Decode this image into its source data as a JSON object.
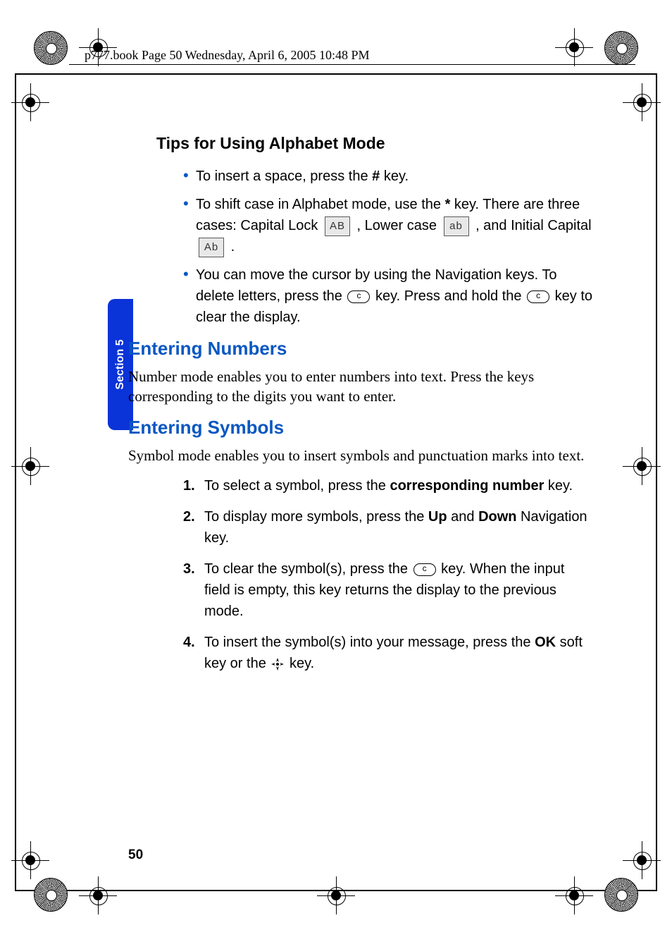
{
  "header": {
    "running": "p777.book  Page 50  Wednesday, April 6, 2005  10:48 PM"
  },
  "sidebar_tab": "Section 5",
  "page_number": "50",
  "tips_heading": "Tips for Using Alphabet Mode",
  "bullets": {
    "b1_pre": "To insert a space, press the ",
    "b1_bold": "#",
    "b1_post": " key.",
    "b2_pre": "To shift case in Alphabet mode, use the ",
    "b2_bold": "*",
    "b2_post1": " key. There are three cases: Capital Lock ",
    "b2_post2": " , Lower case ",
    "b2_post3": " , and Initial Capital ",
    "b2_post4": " .",
    "b3_pre": "You can move the cursor by using the Navigation keys. To delete letters, press the ",
    "b3_mid": " key. Press and hold the ",
    "b3_post": " key to clear the display."
  },
  "case_icons": {
    "caps": "AB",
    "lower": "ab",
    "initial": "Ab"
  },
  "numbers_heading": "Entering Numbers",
  "numbers_body": "Number mode enables you to enter numbers into text. Press the keys corresponding to the digits you want to enter.",
  "symbols_heading": "Entering Symbols",
  "symbols_body": "Symbol mode enables you to insert symbols and punctuation marks into text.",
  "steps": {
    "s1_pre": "To select a symbol, press the ",
    "s1_bold": "corresponding number",
    "s1_post": " key.",
    "s2_pre": "To display more symbols, press the ",
    "s2_bold1": "Up",
    "s2_mid": " and ",
    "s2_bold2": "Down",
    "s2_post": " Navigation key.",
    "s3_pre": "To clear the symbol(s), press the ",
    "s3_post": " key. When the input field is empty, this key returns the display to the previous mode.",
    "s4_pre": "To insert the symbol(s) into your message, press the ",
    "s4_bold": "OK",
    "s4_mid": " soft key or the ",
    "s4_post": " key."
  }
}
